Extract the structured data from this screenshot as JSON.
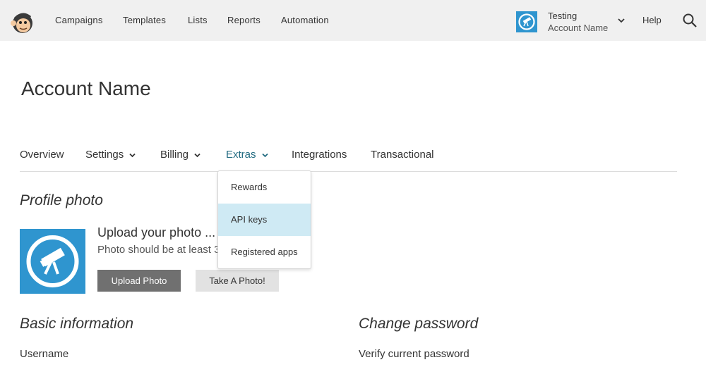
{
  "topnav": {
    "items": [
      "Campaigns",
      "Templates",
      "Lists",
      "Reports",
      "Automation"
    ],
    "account_name": "Testing",
    "account_sub": "Account Name",
    "help": "Help"
  },
  "page": {
    "title": "Account Name"
  },
  "tabs": [
    {
      "label": "Overview"
    },
    {
      "label": "Settings"
    },
    {
      "label": "Billing"
    },
    {
      "label": "Extras"
    },
    {
      "label": "Integrations"
    },
    {
      "label": "Transactional"
    }
  ],
  "dropdown": {
    "items": [
      "Rewards",
      "API keys",
      "Registered apps"
    ],
    "highlighted": "API keys"
  },
  "profile": {
    "heading": "Profile photo",
    "upload_title": "Upload your photo ...",
    "upload_sub": "Photo should be at least 3",
    "upload_button": "Upload Photo",
    "take_photo_button": "Take A Photo!"
  },
  "basic": {
    "heading": "Basic information",
    "username_label": "Username"
  },
  "password": {
    "heading": "Change password",
    "verify_label": "Verify current password"
  },
  "colors": {
    "accent": "#236c82",
    "avatar_bg": "#2f95cf",
    "highlight": "#cfeaf4",
    "topbar": "#f0f0f0"
  },
  "icons": [
    "freddie-logo-icon",
    "telescope-icon",
    "chevron-down-icon",
    "search-icon"
  ]
}
